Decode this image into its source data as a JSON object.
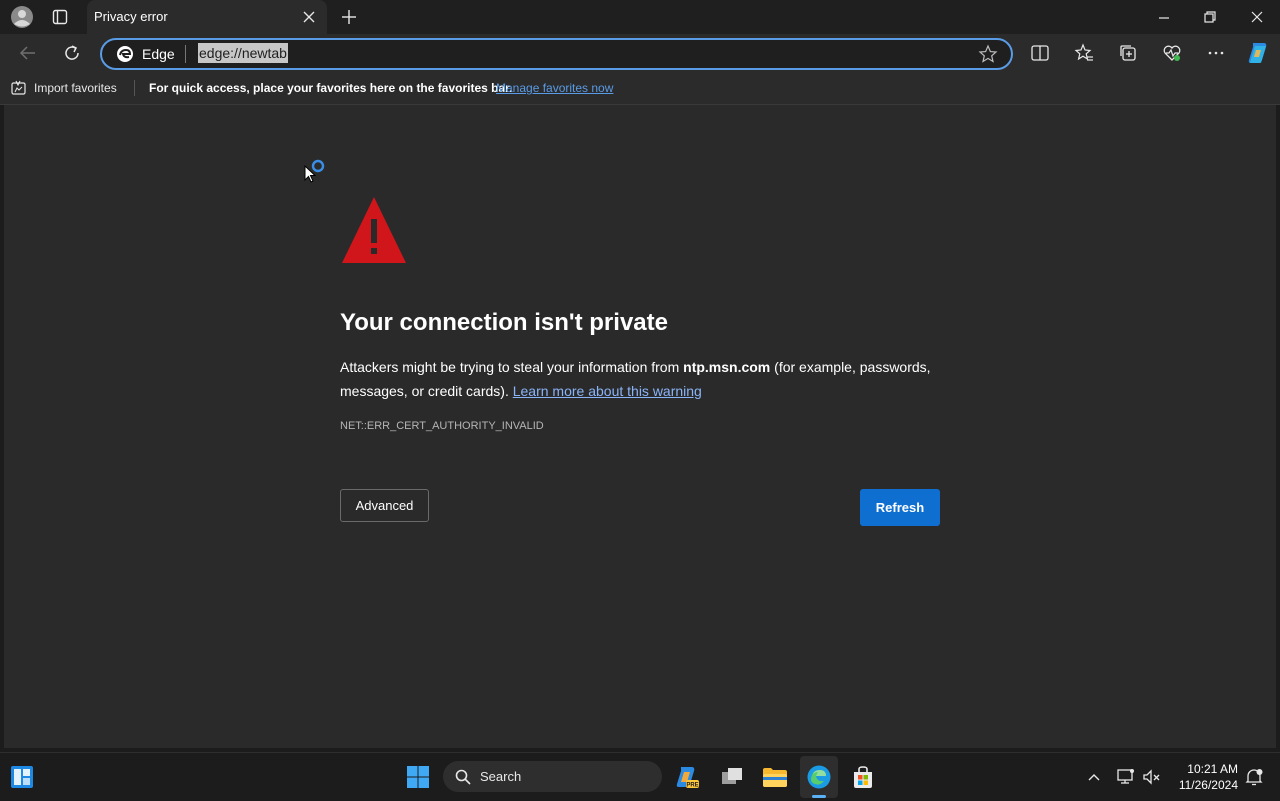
{
  "browser": {
    "tab_title": "Privacy error",
    "address_chip_label": "Edge",
    "url": "edge://newtab"
  },
  "favorites_bar": {
    "import_label": "Import favorites",
    "message": "For quick access, place your favorites here on the favorites bar.",
    "manage_link": "Manage favorites now"
  },
  "error_page": {
    "heading": "Your connection isn't private",
    "desc_prefix": "Attackers might be trying to steal your information from ",
    "host": "ntp.msn.com",
    "desc_suffix": " (for example, passwords, messages, or credit cards). ",
    "learn_more": "Learn more about this warning",
    "error_code": "NET::ERR_CERT_AUTHORITY_INVALID",
    "advanced_label": "Advanced",
    "refresh_label": "Refresh"
  },
  "taskbar": {
    "search_label": "Search",
    "time": "10:21 AM",
    "date": "11/26/2024"
  },
  "colors": {
    "accent": "#0f6fd1",
    "warning": "#d0161b",
    "link": "#8ab4f8"
  }
}
